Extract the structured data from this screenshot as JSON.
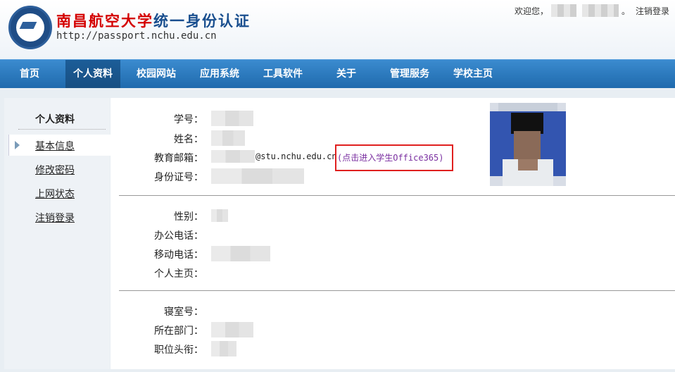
{
  "header": {
    "title_red": "南昌航空大学",
    "title_blue": "统一身份认证",
    "url": "http://passport.nchu.edu.cn",
    "welcome_label": "欢迎您，",
    "dot": "。",
    "logout_label": "注销登录"
  },
  "nav": {
    "items": [
      "首页",
      "个人资料",
      "校园网站",
      "应用系统",
      "工具软件",
      "关于",
      "管理服务",
      "学校主页"
    ],
    "active_index": 1
  },
  "sidebar": {
    "title": "个人资料",
    "items": [
      "基本信息",
      "修改密码",
      "上网状态",
      "注销登录"
    ],
    "active_index": 0
  },
  "profile": {
    "student_id_label": "学号：",
    "name_label": "姓名：",
    "email_label": "教育邮箱：",
    "email_domain": "@stu.nchu.edu.cn",
    "office_link": "(点击进入学生Office365)",
    "id_card_label": "身份证号：",
    "gender_label": "性别：",
    "office_phone_label": "办公电话：",
    "mobile_label": "移动电话：",
    "homepage_label": "个人主页：",
    "dorm_label": "寝室号：",
    "department_label": "所在部门：",
    "title_label": "职位头衔："
  },
  "colors": {
    "nav_bg": "#2a78bd",
    "nav_active": "#1c5d98",
    "highlight_box": "#e0201f",
    "link_purple": "#7a2fa0",
    "title_red": "#d40000",
    "title_blue": "#1a4f8f"
  }
}
